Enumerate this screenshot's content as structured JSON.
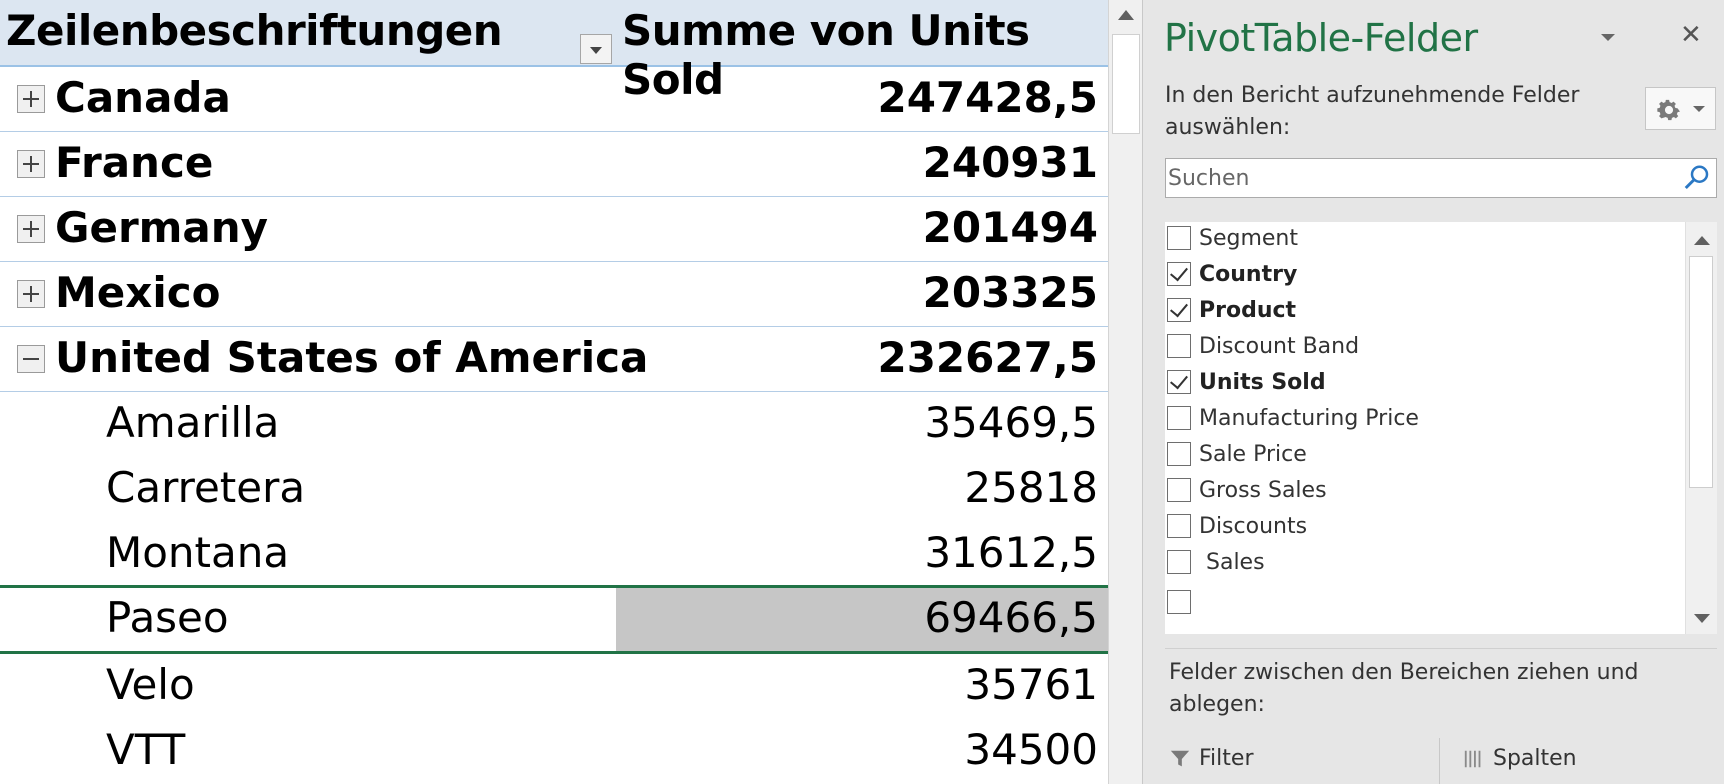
{
  "pivot": {
    "row_label_header": "Zeilenbeschriftungen",
    "value_header": "Summe von Units Sold",
    "rows": [
      {
        "label": "Canada",
        "value": "247428,5",
        "expand_icon": "plus"
      },
      {
        "label": "France",
        "value": "240931",
        "expand_icon": "plus"
      },
      {
        "label": "Germany",
        "value": "201494",
        "expand_icon": "plus"
      },
      {
        "label": "Mexico",
        "value": "203325",
        "expand_icon": "plus"
      },
      {
        "label": "United States of America",
        "value": "232627,5",
        "expand_icon": "minus"
      }
    ],
    "sub_rows": [
      {
        "label": "Amarilla",
        "value": "35469,5"
      },
      {
        "label": "Carretera",
        "value": "25818"
      },
      {
        "label": "Montana",
        "value": "31612,5"
      },
      {
        "label": "Paseo",
        "value": "69466,5"
      },
      {
        "label": "Velo",
        "value": "35761"
      },
      {
        "label": "VTT",
        "value": "34500"
      }
    ]
  },
  "pane": {
    "title": "PivotTable-Felder",
    "description": "In den Bericht aufzunehmende Felder auswählen:",
    "search_placeholder": "Suchen",
    "fields": [
      {
        "label": "Segment",
        "checked": false
      },
      {
        "label": "Country",
        "checked": true
      },
      {
        "label": "Product",
        "checked": true
      },
      {
        "label": "Discount Band",
        "checked": false
      },
      {
        "label": "Units Sold",
        "checked": true
      },
      {
        "label": "Manufacturing Price",
        "checked": false
      },
      {
        "label": "Sale Price",
        "checked": false
      },
      {
        "label": "Gross Sales",
        "checked": false
      },
      {
        "label": "Discounts",
        "checked": false
      },
      {
        "label": " Sales",
        "checked": false
      }
    ],
    "areas_description": "Felder zwischen den Bereichen ziehen und ablegen:",
    "filter_label": "Filter",
    "columns_label": "Spalten",
    "icons": {
      "close": "close-icon",
      "gear": "gear-icon",
      "search": "search-icon",
      "filter": "filter-icon",
      "columns": "columns-icon"
    },
    "accent_color": "#217346"
  }
}
